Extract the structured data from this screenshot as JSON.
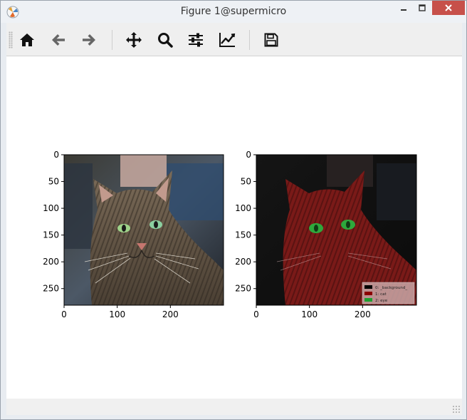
{
  "window": {
    "title": "Figure 1@supermicro",
    "controls": [
      "minimize",
      "maximize",
      "close"
    ]
  },
  "toolbar": {
    "buttons": [
      {
        "name": "home",
        "icon": "home-icon"
      },
      {
        "name": "back",
        "icon": "arrow-left-icon"
      },
      {
        "name": "forward",
        "icon": "arrow-right-icon"
      },
      {
        "name": "pan",
        "icon": "move-icon"
      },
      {
        "name": "zoom",
        "icon": "magnifier-icon"
      },
      {
        "name": "configure-subplots",
        "icon": "sliders-icon"
      },
      {
        "name": "edit-axes",
        "icon": "line-chart-icon"
      },
      {
        "name": "save",
        "icon": "floppy-disk-icon"
      }
    ]
  },
  "figure": {
    "left_panel": {
      "image": "photo of tabby cat",
      "y_ticks": [
        "0",
        "50",
        "100",
        "150",
        "200",
        "250"
      ],
      "x_ticks": [
        "0",
        "100",
        "200"
      ]
    },
    "right_panel": {
      "image": "cat segmentation overlay",
      "y_ticks": [
        "0",
        "50",
        "100",
        "150",
        "200",
        "250"
      ],
      "x_ticks": [
        "0",
        "100",
        "200"
      ],
      "legend": [
        {
          "label": "0: _background_",
          "color": "#000000"
        },
        {
          "label": "1: cat",
          "color": "#8b0000"
        },
        {
          "label": "2: eye",
          "color": "#1f9f2f"
        }
      ]
    }
  },
  "colors": {
    "toolbar_icon": "#111111",
    "toolbar_icon_disabled": "#666666",
    "close_button": "#c7504a"
  }
}
